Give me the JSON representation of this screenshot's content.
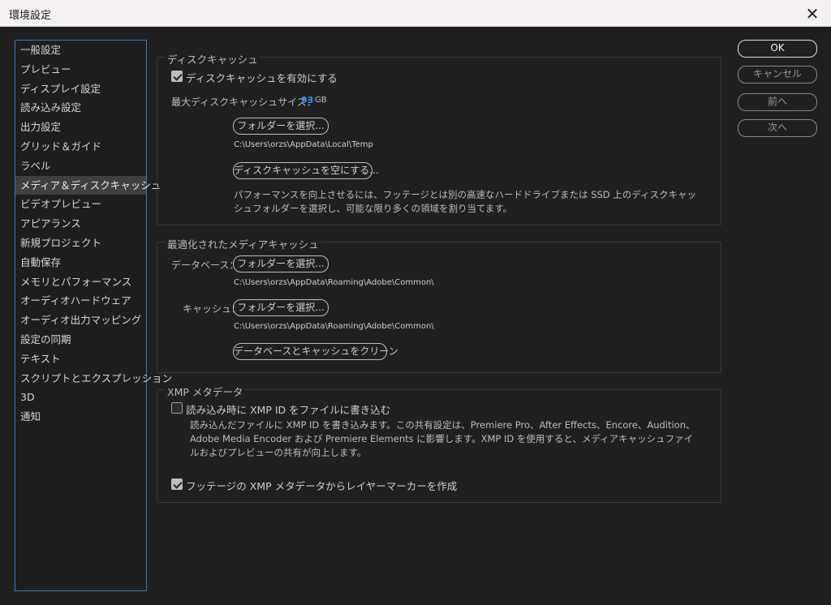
{
  "window": {
    "title": "環境設定",
    "close_glyph": "✕"
  },
  "sidebar": {
    "items": [
      {
        "label": "一般設定"
      },
      {
        "label": "プレビュー"
      },
      {
        "label": "ディスプレイ設定"
      },
      {
        "label": "読み込み設定"
      },
      {
        "label": "出力設定"
      },
      {
        "label": "グリッド＆ガイド"
      },
      {
        "label": "ラベル"
      },
      {
        "label": "メディア＆ディスクキャッシュ",
        "selected": true
      },
      {
        "label": "ビデオプレビュー"
      },
      {
        "label": "アピアランス"
      },
      {
        "label": "新規プロジェクト"
      },
      {
        "label": "自動保存"
      },
      {
        "label": "メモリとパフォーマンス"
      },
      {
        "label": "オーディオハードウェア"
      },
      {
        "label": "オーディオ出力マッピング"
      },
      {
        "label": "設定の同期"
      },
      {
        "label": "テキスト"
      },
      {
        "label": "スクリプトとエクスプレッション"
      },
      {
        "label": "3D"
      },
      {
        "label": "通知"
      }
    ]
  },
  "disk_cache": {
    "title": "ディスクキャッシュ",
    "enable_label": "ディスクキャッシュを有効にする",
    "enable_checked": true,
    "max_size_label": "最大ディスクキャッシュサイズ：",
    "max_size_value": "93",
    "max_size_unit": "GB",
    "choose_folder_button": "フォルダーを選択...",
    "folder_path": "C:\\Users\\orzs\\AppData\\Local\\Temp",
    "empty_cache_button": "ディスクキャッシュを空にする...",
    "description": "パフォーマンスを向上させるには、フッテージとは別の高速なハードドライブまたは SSD 上のディスクキャッシュフォルダーを選択し、可能な限り多くの領域を割り当てます。"
  },
  "media_cache": {
    "title": "最適化されたメディアキャッシュ",
    "database_label": "データベース：",
    "database_button": "フォルダーを選択...",
    "database_path": "C:\\Users\\orzs\\AppData\\Roaming\\Adobe\\Common\\",
    "cache_label": "キャッシュ：",
    "cache_button": "フォルダーを選択...",
    "cache_path": "C:\\Users\\orzs\\AppData\\Roaming\\Adobe\\Common\\",
    "clean_button": "データベースとキャッシュをクリーン"
  },
  "xmp": {
    "title": "XMP メタデータ",
    "write_label": "読み込み時に XMP ID をファイルに書き込む",
    "write_checked": false,
    "write_description": "読み込んだファイルに XMP ID を書き込みます。この共有設定は、Premiere Pro、After Effects、Encore、Audition、Adobe Media Encoder および Premiere Elements に影響します。XMP ID を使用すると、メディアキャッシュファイルおよびプレビューの共有が向上します。",
    "markers_label": "フッテージの XMP メタデータからレイヤーマーカーを作成",
    "markers_checked": true
  },
  "actions": {
    "ok": "OK",
    "cancel": "キャンセル",
    "prev": "前へ",
    "next": "次へ"
  }
}
